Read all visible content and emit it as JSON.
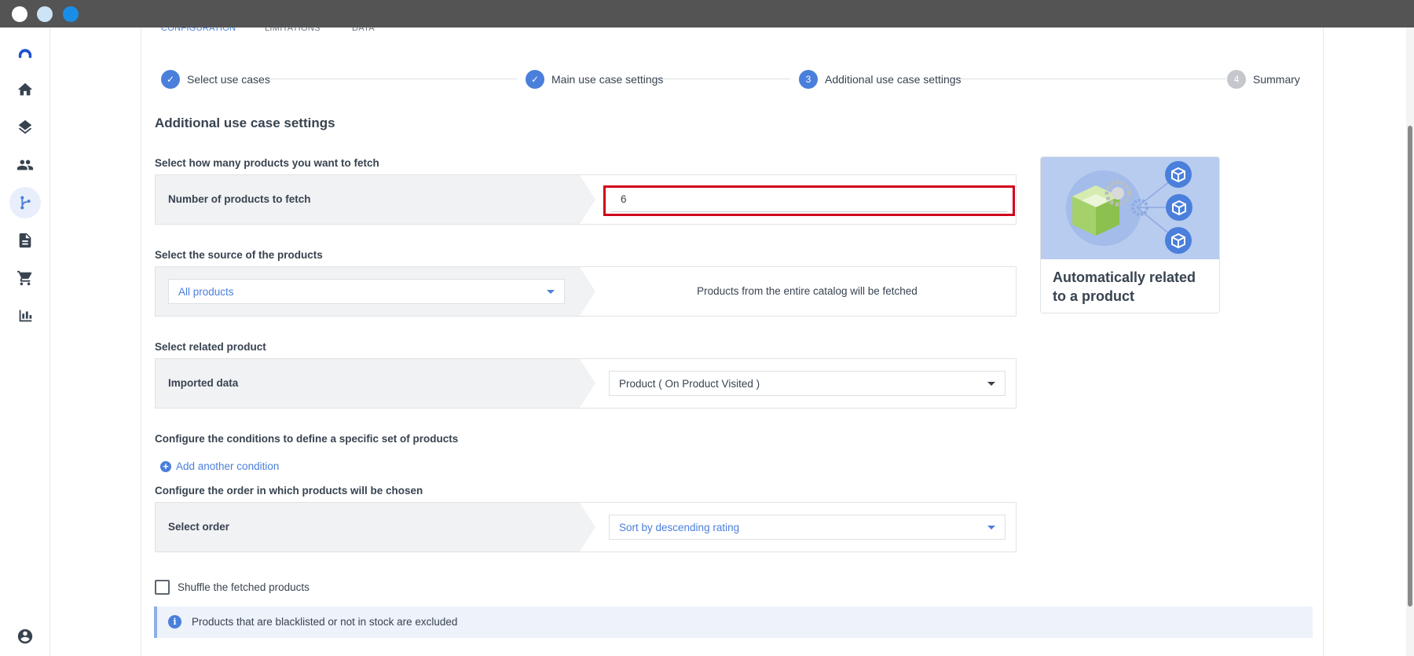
{
  "tabs": [
    "CONFIGURATION",
    "LIMITATIONS",
    "DATA"
  ],
  "stepper": {
    "steps": [
      {
        "label": "Select use cases",
        "state": "done",
        "marker": "✓"
      },
      {
        "label": "Main use case settings",
        "state": "done",
        "marker": "✓"
      },
      {
        "label": "Additional use case settings",
        "state": "current",
        "marker": "3"
      },
      {
        "label": "Summary",
        "state": "pending",
        "marker": "4"
      }
    ]
  },
  "page_title": "Additional use case settings",
  "fetch_count": {
    "section_label": "Select how many products you want to fetch",
    "row_label": "Number of products to fetch",
    "value": "6"
  },
  "source": {
    "section_label": "Select the source of the products",
    "selected": "All products",
    "description": "Products from the entire catalog will be fetched"
  },
  "related": {
    "section_label": "Select related product",
    "row_label": "Imported data",
    "selected": "Product ( On Product Visited )"
  },
  "conditions": {
    "section_label": "Configure the conditions to define a specific set of products",
    "add_label": "Add another condition"
  },
  "order": {
    "section_label": "Configure the order in which products will be chosen",
    "row_label": "Select order",
    "selected": "Sort by descending rating"
  },
  "shuffle": {
    "label": "Shuffle the fetched products",
    "checked": false
  },
  "info": {
    "text": "Products that are blacklisted or not in stock are excluded"
  },
  "card": {
    "title": "Automatically related to a product"
  },
  "colors": {
    "accent": "#4a7fdb",
    "highlight": "#d0021b",
    "titlebar": "#545454",
    "step_pending": "#c4c7cc"
  },
  "sidebar": {
    "items": [
      "logo-icon",
      "home-icon",
      "layers-icon",
      "people-icon",
      "flow-icon",
      "document-icon",
      "cart-icon",
      "chart-icon"
    ],
    "bottom": "user-icon"
  }
}
